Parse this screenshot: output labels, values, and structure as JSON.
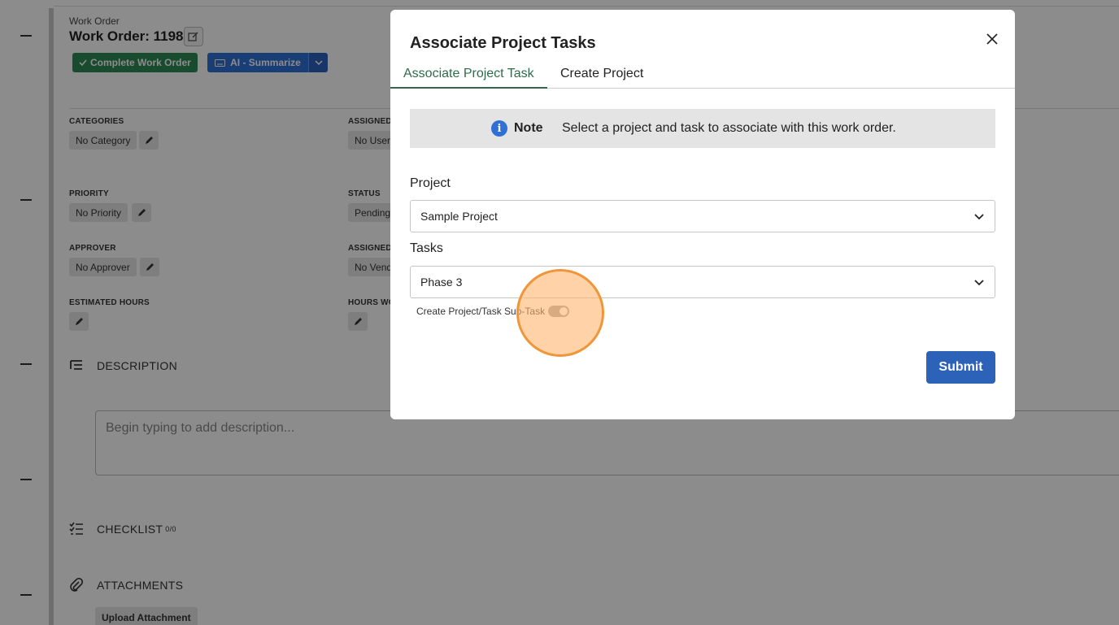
{
  "work_order": {
    "label": "Work Order",
    "title": "Work Order: 1198",
    "complete_button": "Complete Work Order",
    "ai_button": "AI - Summarize"
  },
  "fields": {
    "categories": {
      "label": "CATEGORIES",
      "value": "No Category"
    },
    "assigned": {
      "label": "ASSIGNED",
      "value": "No User"
    },
    "priority": {
      "label": "PRIORITY",
      "value": "No Priority"
    },
    "status": {
      "label": "STATUS",
      "value": "Pending"
    },
    "approver": {
      "label": "APPROVER",
      "value": "No Approver"
    },
    "assigned_vendor": {
      "label": "ASSIGNED",
      "value": "No Vend"
    },
    "estimated_hours": {
      "label": "ESTIMATED HOURS"
    },
    "hours_worked": {
      "label": "HOURS WO"
    }
  },
  "sections": {
    "description": "DESCRIPTION",
    "description_placeholder": "Begin typing to add description...",
    "checklist": "CHECKLIST",
    "checklist_count": "0/0",
    "attachments": "ATTACHMENTS",
    "upload_button": "Upload Attachment"
  },
  "modal": {
    "title": "Associate Project Tasks",
    "tabs": [
      {
        "label": "Associate Project Task",
        "active": true
      },
      {
        "label": "Create Project",
        "active": false
      }
    ],
    "note": {
      "label": "Note",
      "text": "Select a project and task to associate with this work order."
    },
    "project": {
      "label": "Project",
      "value": "Sample Project"
    },
    "tasks": {
      "label": "Tasks",
      "value": "Phase 3"
    },
    "toggle": {
      "label": "Create Project/Task Sub-Task",
      "on": false
    },
    "submit_label": "Submit"
  },
  "colors": {
    "accent_green": "#2e6b4a",
    "complete_green": "#2e8a57",
    "ai_blue": "#2f6fd6",
    "submit_blue": "#2c62b8",
    "click_marker": "#f0963a"
  }
}
